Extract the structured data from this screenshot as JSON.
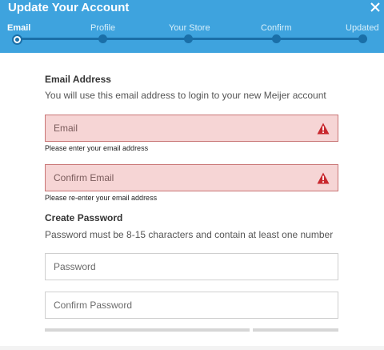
{
  "header": {
    "title": "Update Your Account",
    "close_icon": "close-icon",
    "steps": [
      {
        "label": "Email",
        "active": true
      },
      {
        "label": "Profile",
        "active": false
      },
      {
        "label": "Your Store",
        "active": false
      },
      {
        "label": "Confirm",
        "active": false
      },
      {
        "label": "Updated",
        "active": false
      }
    ]
  },
  "email_section": {
    "title": "Email Address",
    "description": "You will use this email address to login to your new Meijer account",
    "email_placeholder": "Email",
    "email_error": "Please enter your email address",
    "confirm_placeholder": "Confirm Email",
    "confirm_error": "Please re-enter your email address"
  },
  "password_section": {
    "title": "Create Password",
    "description": "Password must be 8-15 characters and contain at least one number",
    "password_placeholder": "Password",
    "confirm_placeholder": "Confirm Password"
  },
  "colors": {
    "header_bg": "#3ea3de",
    "track": "#1a6fa8",
    "error_bg": "#f6d5d5",
    "warning_icon": "#c8282e"
  }
}
